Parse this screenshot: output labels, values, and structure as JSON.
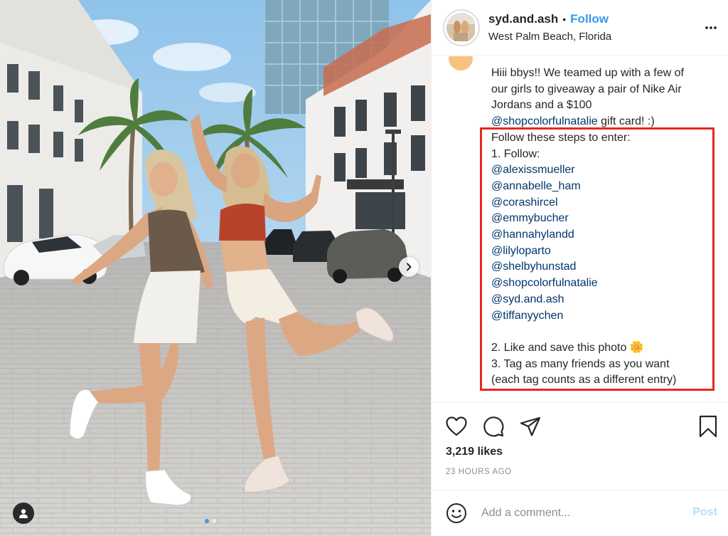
{
  "post": {
    "username": "syd.and.ash",
    "bullet": "•",
    "follow_label": "Follow",
    "location": "West Palm Beach, Florida",
    "caption_lines": [
      "Hiii bbys!! We teamed up with a few of",
      "our girls to giveaway a pair of Nike Air",
      "Jordans and a $100",
      "@shopcolorfulnatalie gift card! :)",
      "Follow these steps to enter:",
      "1. Follow:",
      "@alexissmueller",
      "@annabelle_ham",
      "@corashircel",
      "@emmybucher",
      "@hannahylandd",
      "@lilyloparto",
      "@shelbyhunstad",
      "@shopcolorfulnatalie",
      "@syd.and.ash",
      "@tiffanyychen",
      "",
      "2. Like and save this photo 🌼",
      "3. Tag as many friends as you want",
      "(each tag counts as a different entry)"
    ],
    "likes": "3,219 likes",
    "timestamp": "23 HOURS AGO",
    "comment_placeholder": "Add a comment...",
    "post_label": "Post",
    "carousel": {
      "slide_count": 2,
      "active_index": 0
    },
    "icons": {
      "more": "more-options-icon",
      "like": "heart-icon",
      "comment": "comment-bubble-icon",
      "share": "paper-plane-icon",
      "save": "bookmark-icon",
      "emoji": "smiley-icon",
      "next": "chevron-right-icon",
      "tagged": "user-icon"
    },
    "colors": {
      "link": "#3897f0",
      "mention": "#00376b",
      "highlight": "#e8291e",
      "post_disabled": "#b2dffc"
    }
  }
}
